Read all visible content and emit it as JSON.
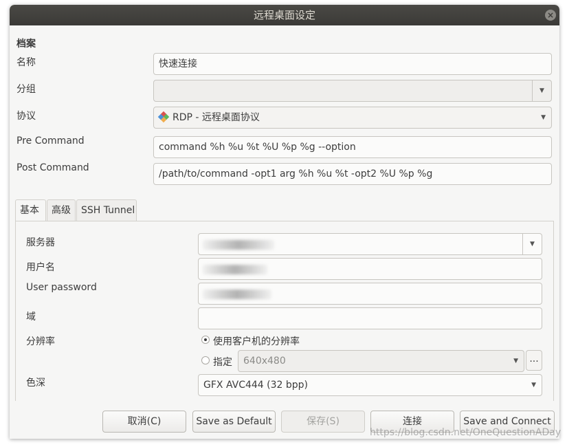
{
  "window": {
    "title": "远程桌面设定",
    "close_glyph": "×"
  },
  "profile": {
    "section_title": "档案",
    "name_label": "名称",
    "name_value": "快速连接",
    "group_label": "分组",
    "group_value": "",
    "protocol_label": "协议",
    "protocol_value": "RDP - 远程桌面协议",
    "pre_command_label": "Pre Command",
    "pre_command_value": "command %h %u %t %U %p %g --option",
    "post_command_label": "Post Command",
    "post_command_value": "/path/to/command -opt1 arg %h %u %t -opt2 %U %p %g"
  },
  "tabs": [
    {
      "label": "基本",
      "active": true
    },
    {
      "label": "高级",
      "active": false
    },
    {
      "label": "SSH Tunnel",
      "active": false
    }
  ],
  "basic": {
    "server_label": "服务器",
    "username_label": "用户名",
    "password_label": "User password",
    "domain_label": "域",
    "domain_value": "",
    "resolution_label": "分辨率",
    "resolution_client_label": "使用客户机的分辨率",
    "resolution_custom_label": "指定",
    "resolution_custom_value": "640x480",
    "resolution_more_label": "...",
    "color_depth_label": "色深",
    "color_depth_value": "GFX AVC444 (32 bpp)",
    "resolution_selected": "client"
  },
  "buttons": {
    "cancel": "取消(C)",
    "save_default": "Save as Default",
    "save": "保存(S)",
    "connect": "连接",
    "save_connect": "Save and Connect"
  },
  "watermark": "https://blog.csdn.net/OneQuestionADay",
  "icons": {
    "close": "close-icon",
    "dropdown": "chevron-down-icon",
    "protocol": "rdp-protocol-icon"
  },
  "colors": {
    "titlebar": "#3b3a37",
    "window_bg": "#f6f6f5",
    "rdp_icon": [
      "#d9534f",
      "#5cb85c",
      "#f0ad4e",
      "#4a90d9"
    ]
  }
}
